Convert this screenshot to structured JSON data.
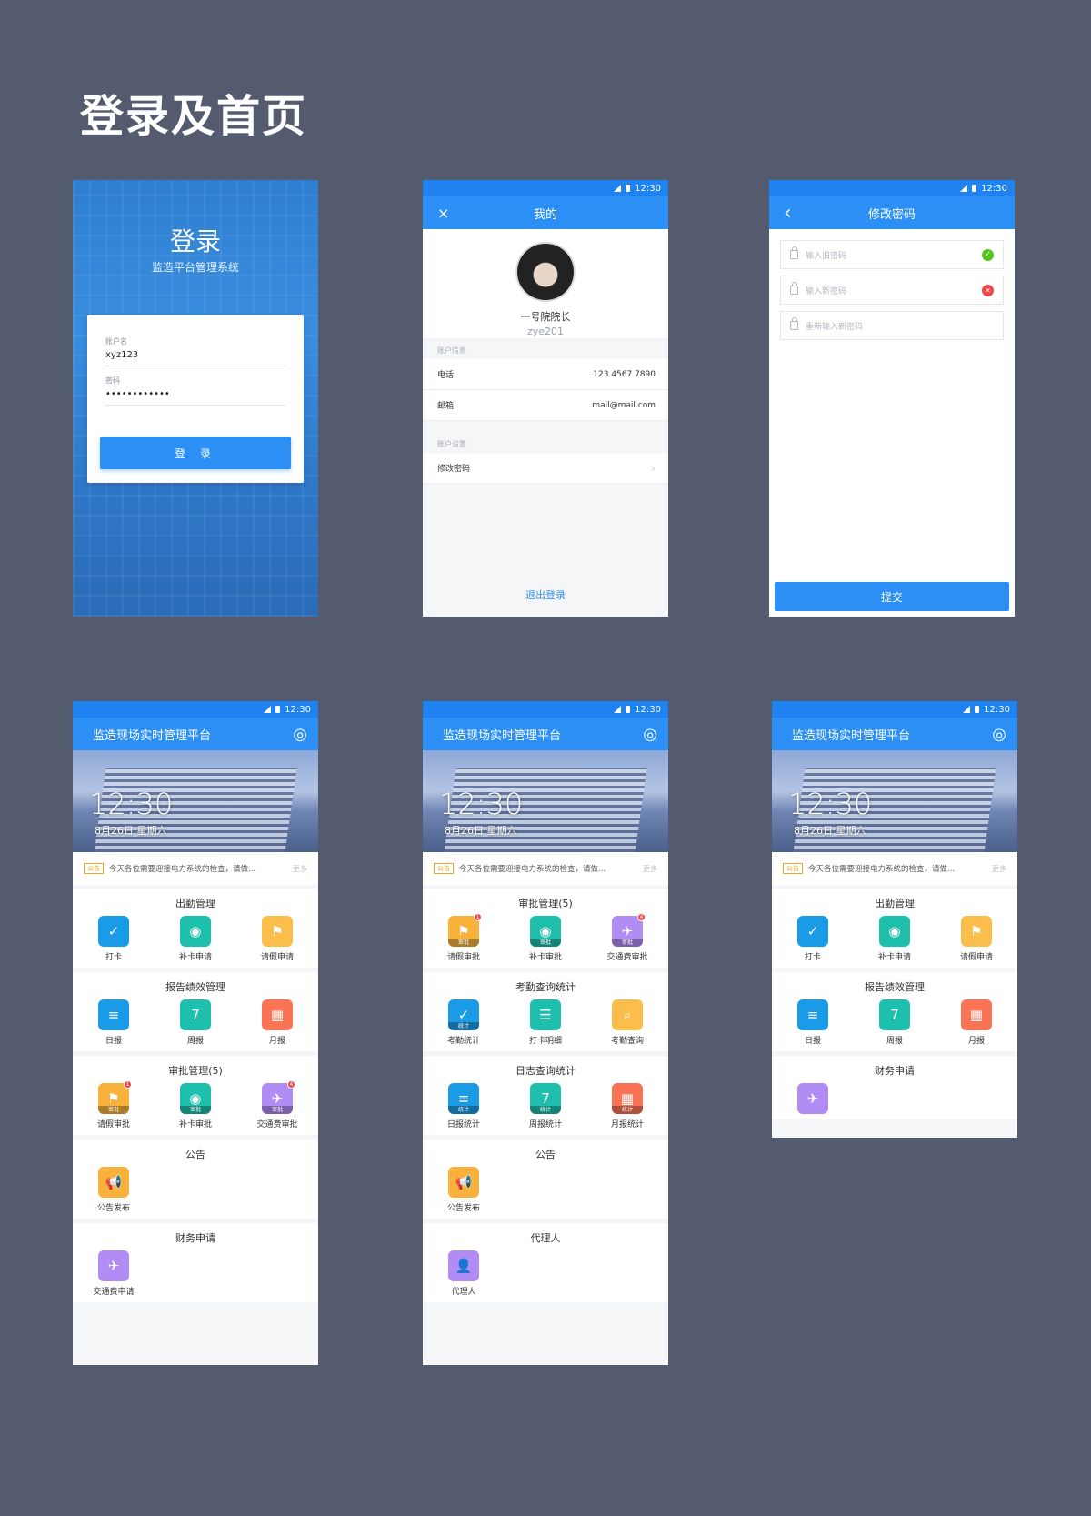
{
  "page": {
    "title": "登录及首页"
  },
  "status": {
    "time": "12:30"
  },
  "login": {
    "title": "登录",
    "subtitle": "监造平台管理系统",
    "username_label": "账户名",
    "username_value": "xyz123",
    "password_label": "密码",
    "password_value": "••••••••••••",
    "login_button": "登 录"
  },
  "profile": {
    "nav_title": "我的",
    "close_icon": "×",
    "name": "一号院院长",
    "user_id": "zye201",
    "account_info_label": "账户信息",
    "phone_label": "电话",
    "phone_value": "123 4567 7890",
    "email_label": "邮箱",
    "email_value": "mail@mail.com",
    "account_settings_label": "账户设置",
    "change_password": "修改密码",
    "chevron": "›",
    "logout": "退出登录"
  },
  "password": {
    "nav_title": "修改密码",
    "back_icon": "‹",
    "old_placeholder": "输入旧密码",
    "new_placeholder": "输入新密码",
    "confirm_placeholder": "重新输入新密码",
    "submit": "提交"
  },
  "home": {
    "app_title": "监造现场实时管理平台",
    "hero_time": "12:30",
    "hero_date": "8月26日 星期六",
    "notice_tag": "公告",
    "notice_text": "今天各位需要迎接电力系统的检查，请做...",
    "notice_more": "更多",
    "attendance": {
      "title": "出勤管理",
      "items": [
        "打卡",
        "补卡申请",
        "请假申请"
      ]
    },
    "report": {
      "title": "报告绩效管理",
      "items": [
        "日报",
        "周报",
        "月报"
      ]
    },
    "approval": {
      "title": "审批管理(5)",
      "items": [
        "请假审批",
        "补卡审批",
        "交通费审批"
      ],
      "sub": "审批",
      "badges": [
        "1",
        "4"
      ]
    },
    "announce": {
      "title": "公告",
      "items": [
        "公告发布"
      ]
    },
    "finance": {
      "title": "财务申请",
      "items": [
        "交通费申请"
      ]
    },
    "attend_stats": {
      "title": "考勤查询统计",
      "items": [
        "考勤统计",
        "打卡明细",
        "考勤查询"
      ],
      "sub": "统计"
    },
    "log_stats": {
      "title": "日志查询统计",
      "items": [
        "日报统计",
        "周报统计",
        "月报统计"
      ],
      "sub": "统计"
    },
    "agent": {
      "title": "代理人",
      "items": [
        "代理人"
      ]
    }
  },
  "icons": {
    "check": "✓",
    "pin": "◉",
    "flag": "⚑",
    "lines": "≡",
    "calendar": "7",
    "grid": "▦",
    "plane": "✈",
    "megaphone": "📢",
    "search": "⌕",
    "list": "☰",
    "person": "👤",
    "account": "◎"
  },
  "colors": {
    "primary": "#2b8ff6",
    "background": "#555b6e"
  }
}
